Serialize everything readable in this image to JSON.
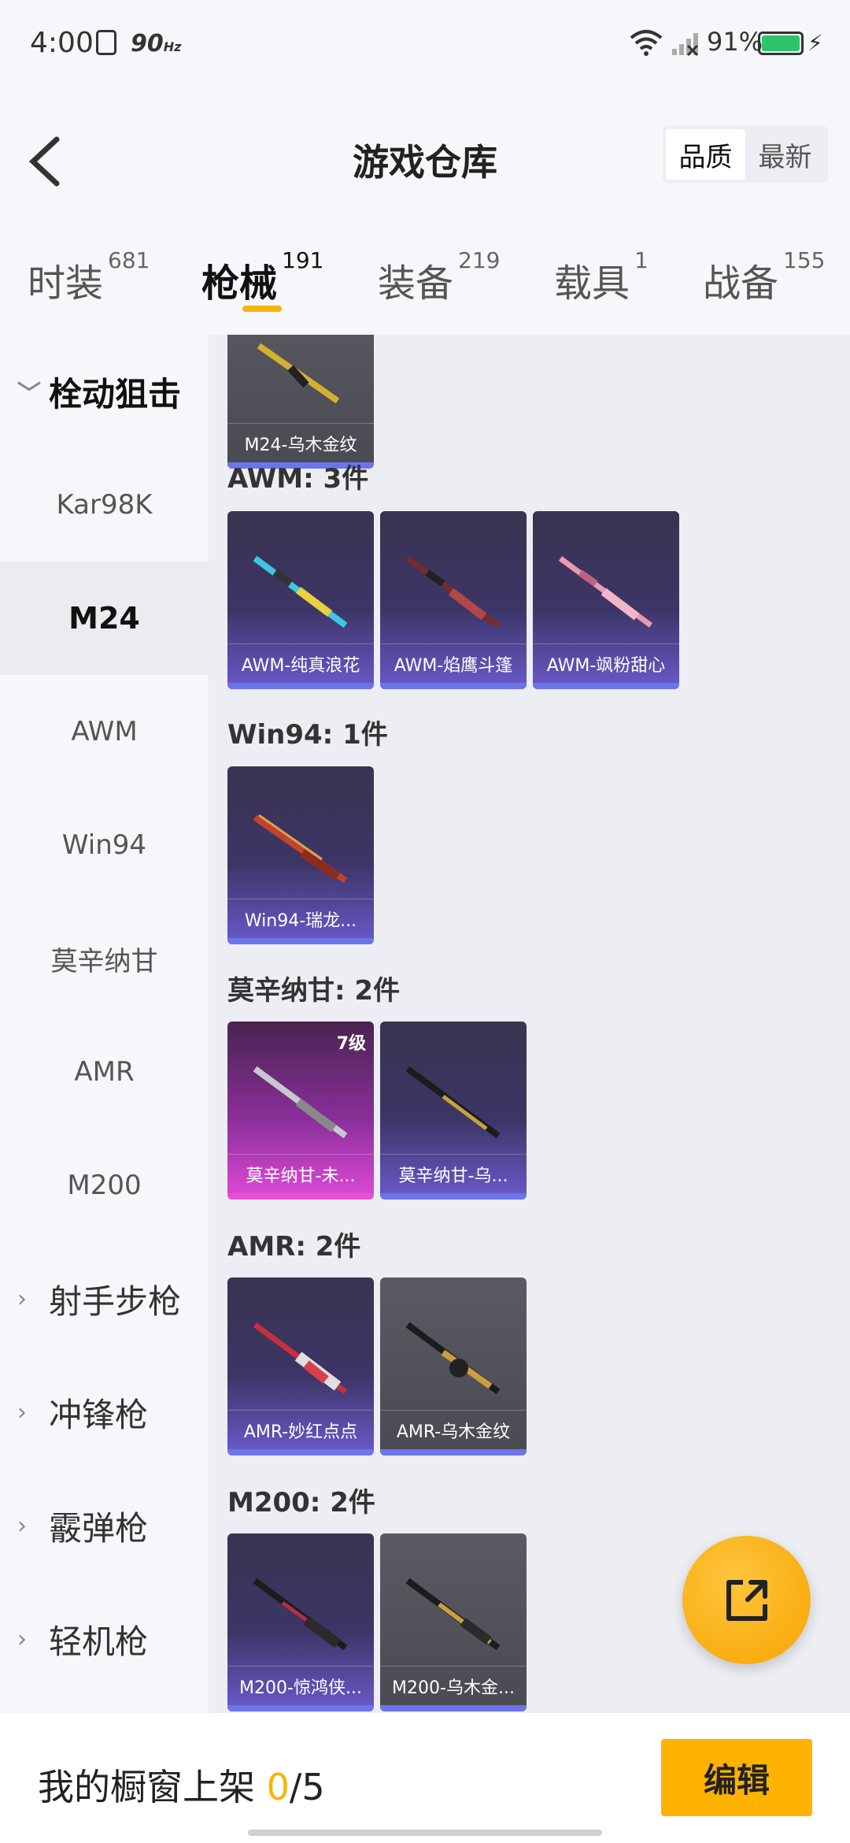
{
  "status": {
    "time": "4:00",
    "refresh": "90",
    "refresh_unit": "Hz",
    "battery": "91%"
  },
  "header": {
    "title": "游戏仓库",
    "sort_options": [
      "品质",
      "最新"
    ]
  },
  "tabs": [
    {
      "label": "时装",
      "count": "681"
    },
    {
      "label": "枪械",
      "count": "191"
    },
    {
      "label": "装备",
      "count": "219"
    },
    {
      "label": "载具",
      "count": "1"
    },
    {
      "label": "战备",
      "count": "155"
    }
  ],
  "sidebar": {
    "open_group": "栓动狙击",
    "items": [
      "Kar98K",
      "M24",
      "AWM",
      "Win94",
      "莫辛纳甘",
      "AMR",
      "M200"
    ],
    "groups": [
      "射手步枪",
      "冲锋枪",
      "霰弹枪",
      "轻机枪"
    ]
  },
  "content": {
    "m24_card": "M24-乌木金纹",
    "sections": [
      {
        "title": "AWM: 3件",
        "cards": [
          "AWM-纯真浪花",
          "AWM-焰鹰斗篷",
          "AWM-飒粉甜心"
        ]
      },
      {
        "title": "Win94: 1件",
        "cards": [
          "Win94-瑞龙..."
        ]
      },
      {
        "title": "莫辛纳甘: 2件",
        "cards": [
          "莫辛纳甘-未...",
          "莫辛纳甘-乌..."
        ],
        "level": "7级"
      },
      {
        "title": "AMR: 2件",
        "cards": [
          "AMR-妙红点点",
          "AMR-乌木金纹"
        ]
      },
      {
        "title": "M200: 2件",
        "cards": [
          "M200-惊鸿侠...",
          "M200-乌木金..."
        ]
      }
    ]
  },
  "bottom": {
    "showcase_label": "我的橱窗上架 ",
    "current": "0",
    "total": "/5",
    "edit_label": "编辑"
  }
}
